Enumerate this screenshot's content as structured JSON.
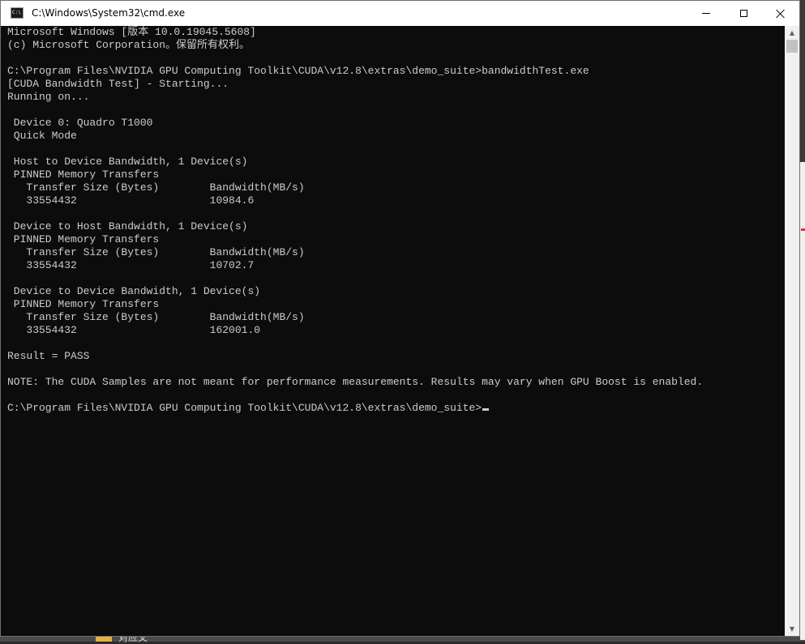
{
  "window": {
    "title": "C:\\Windows\\System32\\cmd.exe",
    "icon_label": "C:\\"
  },
  "console": {
    "lines": [
      "Microsoft Windows [版本 10.0.19045.5608]",
      "(c) Microsoft Corporation。保留所有权利。",
      "",
      "C:\\Program Files\\NVIDIA GPU Computing Toolkit\\CUDA\\v12.8\\extras\\demo_suite>bandwidthTest.exe",
      "[CUDA Bandwidth Test] - Starting...",
      "Running on...",
      "",
      " Device 0: Quadro T1000",
      " Quick Mode",
      "",
      " Host to Device Bandwidth, 1 Device(s)",
      " PINNED Memory Transfers",
      "   Transfer Size (Bytes)        Bandwidth(MB/s)",
      "   33554432                     10984.6",
      "",
      " Device to Host Bandwidth, 1 Device(s)",
      " PINNED Memory Transfers",
      "   Transfer Size (Bytes)        Bandwidth(MB/s)",
      "   33554432                     10702.7",
      "",
      " Device to Device Bandwidth, 1 Device(s)",
      " PINNED Memory Transfers",
      "   Transfer Size (Bytes)        Bandwidth(MB/s)",
      "   33554432                     162001.0",
      "",
      "Result = PASS",
      "",
      "NOTE: The CUDA Samples are not meant for performance measurements. Results may vary when GPU Boost is enabled.",
      ""
    ],
    "prompt": "C:\\Program Files\\NVIDIA GPU Computing Toolkit\\CUDA\\v12.8\\extras\\demo_suite>"
  },
  "desktop": {
    "file_label": "对应文"
  },
  "colors": {
    "console_bg": "#0c0c0c",
    "console_fg": "#cccccc",
    "titlebar_bg": "#ffffff"
  },
  "icons": {
    "app": "cmd-icon",
    "minimize": "minimize-icon",
    "maximize": "maximize-icon",
    "close": "close-icon"
  }
}
